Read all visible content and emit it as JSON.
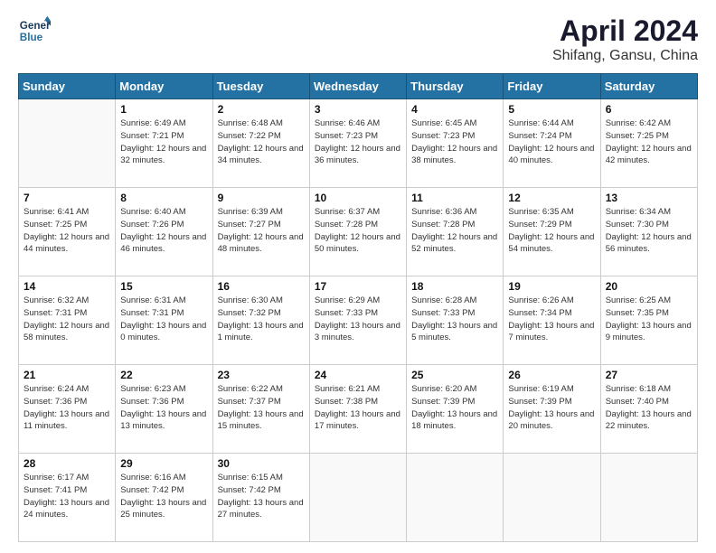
{
  "logo": {
    "line1": "General",
    "line2": "Blue"
  },
  "title": "April 2024",
  "subtitle": "Shifang, Gansu, China",
  "days_header": [
    "Sunday",
    "Monday",
    "Tuesday",
    "Wednesday",
    "Thursday",
    "Friday",
    "Saturday"
  ],
  "weeks": [
    [
      {
        "num": "",
        "sunrise": "",
        "sunset": "",
        "daylight": ""
      },
      {
        "num": "1",
        "sunrise": "Sunrise: 6:49 AM",
        "sunset": "Sunset: 7:21 PM",
        "daylight": "Daylight: 12 hours and 32 minutes."
      },
      {
        "num": "2",
        "sunrise": "Sunrise: 6:48 AM",
        "sunset": "Sunset: 7:22 PM",
        "daylight": "Daylight: 12 hours and 34 minutes."
      },
      {
        "num": "3",
        "sunrise": "Sunrise: 6:46 AM",
        "sunset": "Sunset: 7:23 PM",
        "daylight": "Daylight: 12 hours and 36 minutes."
      },
      {
        "num": "4",
        "sunrise": "Sunrise: 6:45 AM",
        "sunset": "Sunset: 7:23 PM",
        "daylight": "Daylight: 12 hours and 38 minutes."
      },
      {
        "num": "5",
        "sunrise": "Sunrise: 6:44 AM",
        "sunset": "Sunset: 7:24 PM",
        "daylight": "Daylight: 12 hours and 40 minutes."
      },
      {
        "num": "6",
        "sunrise": "Sunrise: 6:42 AM",
        "sunset": "Sunset: 7:25 PM",
        "daylight": "Daylight: 12 hours and 42 minutes."
      }
    ],
    [
      {
        "num": "7",
        "sunrise": "Sunrise: 6:41 AM",
        "sunset": "Sunset: 7:25 PM",
        "daylight": "Daylight: 12 hours and 44 minutes."
      },
      {
        "num": "8",
        "sunrise": "Sunrise: 6:40 AM",
        "sunset": "Sunset: 7:26 PM",
        "daylight": "Daylight: 12 hours and 46 minutes."
      },
      {
        "num": "9",
        "sunrise": "Sunrise: 6:39 AM",
        "sunset": "Sunset: 7:27 PM",
        "daylight": "Daylight: 12 hours and 48 minutes."
      },
      {
        "num": "10",
        "sunrise": "Sunrise: 6:37 AM",
        "sunset": "Sunset: 7:28 PM",
        "daylight": "Daylight: 12 hours and 50 minutes."
      },
      {
        "num": "11",
        "sunrise": "Sunrise: 6:36 AM",
        "sunset": "Sunset: 7:28 PM",
        "daylight": "Daylight: 12 hours and 52 minutes."
      },
      {
        "num": "12",
        "sunrise": "Sunrise: 6:35 AM",
        "sunset": "Sunset: 7:29 PM",
        "daylight": "Daylight: 12 hours and 54 minutes."
      },
      {
        "num": "13",
        "sunrise": "Sunrise: 6:34 AM",
        "sunset": "Sunset: 7:30 PM",
        "daylight": "Daylight: 12 hours and 56 minutes."
      }
    ],
    [
      {
        "num": "14",
        "sunrise": "Sunrise: 6:32 AM",
        "sunset": "Sunset: 7:31 PM",
        "daylight": "Daylight: 12 hours and 58 minutes."
      },
      {
        "num": "15",
        "sunrise": "Sunrise: 6:31 AM",
        "sunset": "Sunset: 7:31 PM",
        "daylight": "Daylight: 13 hours and 0 minutes."
      },
      {
        "num": "16",
        "sunrise": "Sunrise: 6:30 AM",
        "sunset": "Sunset: 7:32 PM",
        "daylight": "Daylight: 13 hours and 1 minute."
      },
      {
        "num": "17",
        "sunrise": "Sunrise: 6:29 AM",
        "sunset": "Sunset: 7:33 PM",
        "daylight": "Daylight: 13 hours and 3 minutes."
      },
      {
        "num": "18",
        "sunrise": "Sunrise: 6:28 AM",
        "sunset": "Sunset: 7:33 PM",
        "daylight": "Daylight: 13 hours and 5 minutes."
      },
      {
        "num": "19",
        "sunrise": "Sunrise: 6:26 AM",
        "sunset": "Sunset: 7:34 PM",
        "daylight": "Daylight: 13 hours and 7 minutes."
      },
      {
        "num": "20",
        "sunrise": "Sunrise: 6:25 AM",
        "sunset": "Sunset: 7:35 PM",
        "daylight": "Daylight: 13 hours and 9 minutes."
      }
    ],
    [
      {
        "num": "21",
        "sunrise": "Sunrise: 6:24 AM",
        "sunset": "Sunset: 7:36 PM",
        "daylight": "Daylight: 13 hours and 11 minutes."
      },
      {
        "num": "22",
        "sunrise": "Sunrise: 6:23 AM",
        "sunset": "Sunset: 7:36 PM",
        "daylight": "Daylight: 13 hours and 13 minutes."
      },
      {
        "num": "23",
        "sunrise": "Sunrise: 6:22 AM",
        "sunset": "Sunset: 7:37 PM",
        "daylight": "Daylight: 13 hours and 15 minutes."
      },
      {
        "num": "24",
        "sunrise": "Sunrise: 6:21 AM",
        "sunset": "Sunset: 7:38 PM",
        "daylight": "Daylight: 13 hours and 17 minutes."
      },
      {
        "num": "25",
        "sunrise": "Sunrise: 6:20 AM",
        "sunset": "Sunset: 7:39 PM",
        "daylight": "Daylight: 13 hours and 18 minutes."
      },
      {
        "num": "26",
        "sunrise": "Sunrise: 6:19 AM",
        "sunset": "Sunset: 7:39 PM",
        "daylight": "Daylight: 13 hours and 20 minutes."
      },
      {
        "num": "27",
        "sunrise": "Sunrise: 6:18 AM",
        "sunset": "Sunset: 7:40 PM",
        "daylight": "Daylight: 13 hours and 22 minutes."
      }
    ],
    [
      {
        "num": "28",
        "sunrise": "Sunrise: 6:17 AM",
        "sunset": "Sunset: 7:41 PM",
        "daylight": "Daylight: 13 hours and 24 minutes."
      },
      {
        "num": "29",
        "sunrise": "Sunrise: 6:16 AM",
        "sunset": "Sunset: 7:42 PM",
        "daylight": "Daylight: 13 hours and 25 minutes."
      },
      {
        "num": "30",
        "sunrise": "Sunrise: 6:15 AM",
        "sunset": "Sunset: 7:42 PM",
        "daylight": "Daylight: 13 hours and 27 minutes."
      },
      {
        "num": "",
        "sunrise": "",
        "sunset": "",
        "daylight": ""
      },
      {
        "num": "",
        "sunrise": "",
        "sunset": "",
        "daylight": ""
      },
      {
        "num": "",
        "sunrise": "",
        "sunset": "",
        "daylight": ""
      },
      {
        "num": "",
        "sunrise": "",
        "sunset": "",
        "daylight": ""
      }
    ]
  ]
}
